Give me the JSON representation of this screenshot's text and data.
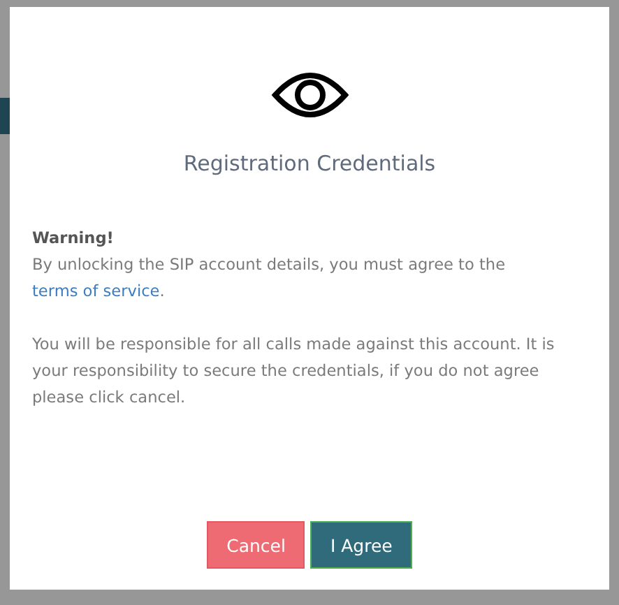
{
  "dialog": {
    "title": "Registration Credentials",
    "warning_heading": "Warning!",
    "paragraphs": [
      {
        "before": "By unlocking the SIP account details, you must agree to the ",
        "link": "terms of service",
        "after": "."
      },
      {
        "before": "You will be responsible for all calls made against this account. It is your responsibility to secure the credentials, if you do not agree please click cancel."
      }
    ],
    "buttons": [
      {
        "label": "Cancel",
        "kind": "cancel"
      },
      {
        "label": "I Agree",
        "kind": "confirm"
      }
    ]
  }
}
